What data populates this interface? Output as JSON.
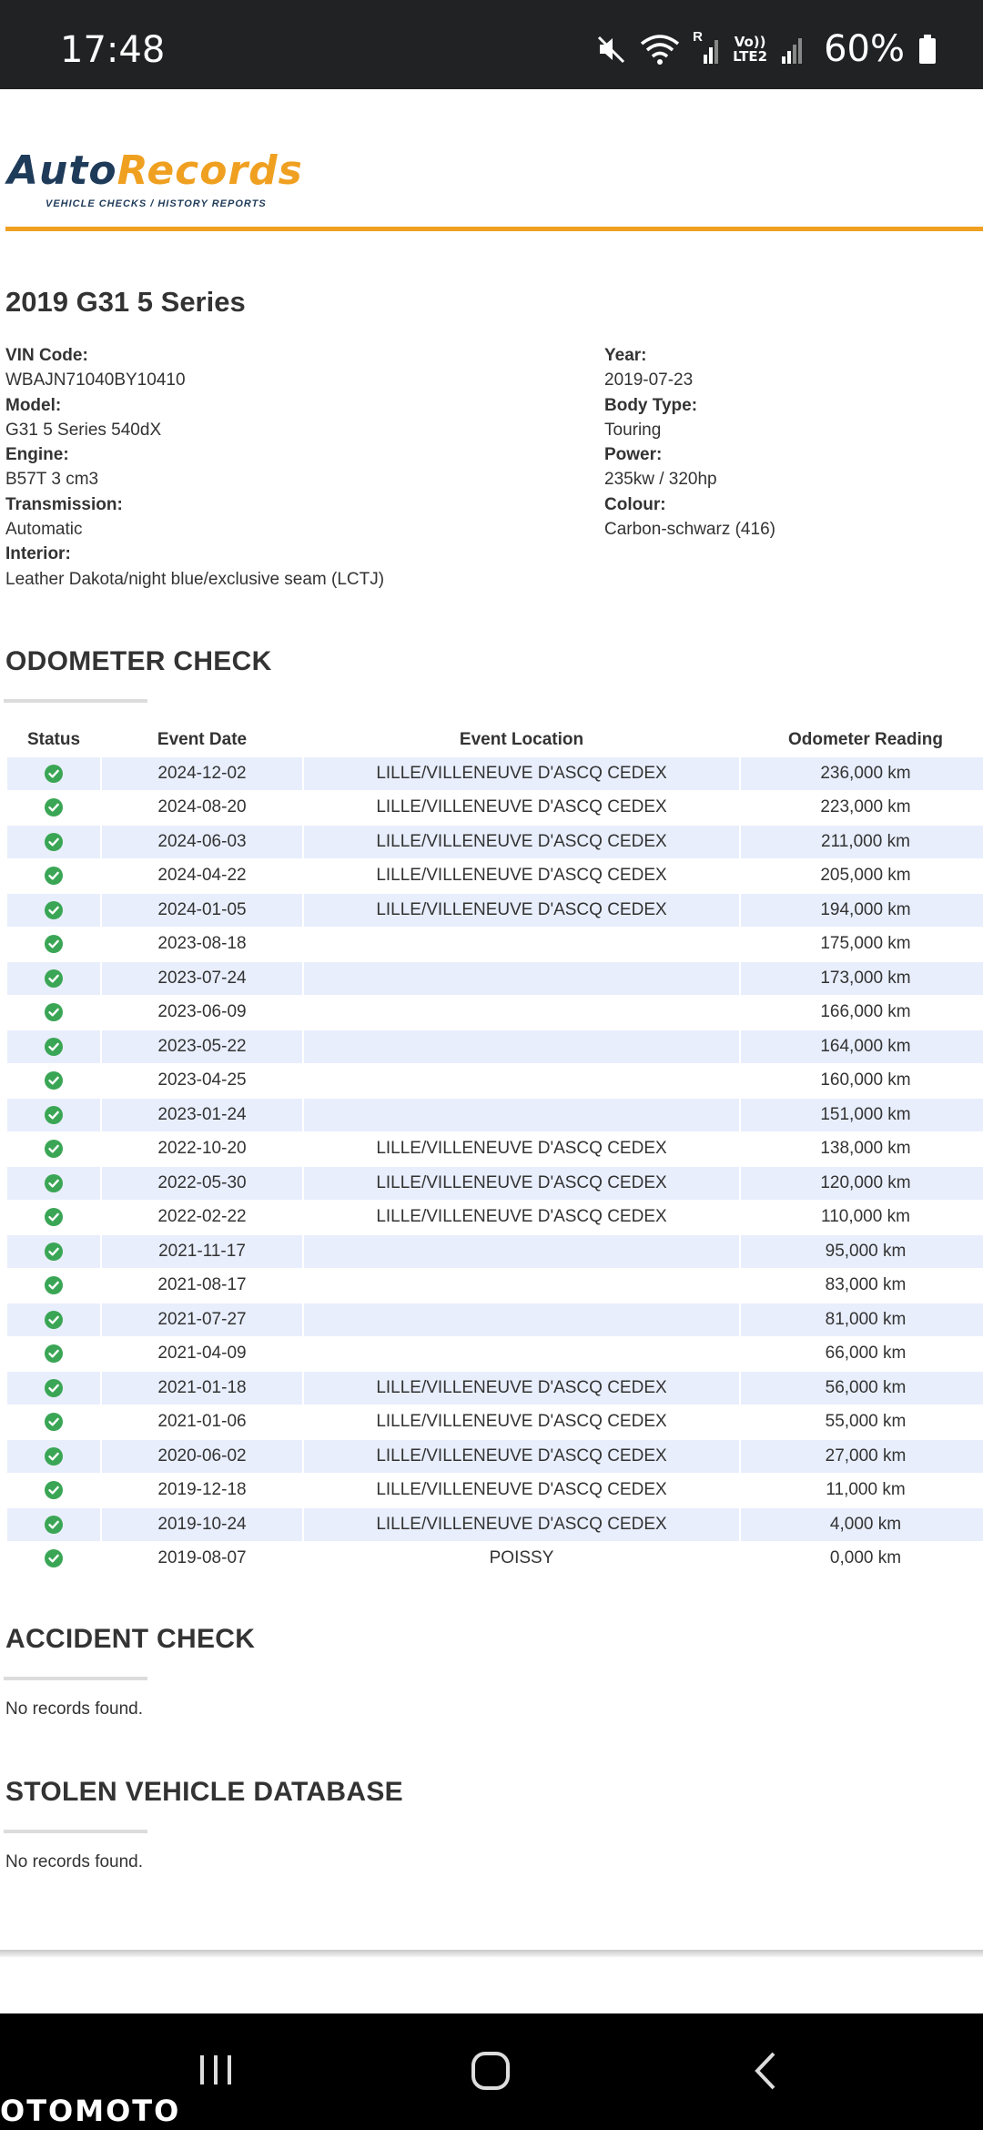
{
  "status_bar": {
    "time": "17:48",
    "battery": "60%",
    "roaming": "R",
    "lte_top": "Vo))",
    "lte_bottom": "LTE2"
  },
  "brand": {
    "auto": "Auto",
    "records": "Records",
    "tagline": "VEHICLE CHECKS / HISTORY REPORTS",
    "color_primary": "#1f3b5a",
    "color_accent": "#f0a020"
  },
  "vehicle": {
    "title": "2019 G31 5 Series",
    "left": [
      {
        "label": "VIN Code:",
        "value": "WBAJN71040BY10410"
      },
      {
        "label": "Model:",
        "value": "G31 5 Series 540dX"
      },
      {
        "label": "Engine:",
        "value": "B57T 3 cm3"
      },
      {
        "label": "Transmission:",
        "value": "Automatic"
      },
      {
        "label": "Interior:",
        "value": "Leather Dakota/night blue/exclusive seam (LCTJ)"
      }
    ],
    "right": [
      {
        "label": "Year:",
        "value": "2019-07-23"
      },
      {
        "label": "Body Type:",
        "value": "Touring"
      },
      {
        "label": "Power:",
        "value": "235kw / 320hp"
      },
      {
        "label": "Colour:",
        "value": "Carbon-schwarz (416)"
      }
    ]
  },
  "odometer": {
    "title": "ODOMETER CHECK",
    "columns": [
      "Status",
      "Event Date",
      "Event Location",
      "Odometer Reading"
    ],
    "status_icon": "check-circle-icon",
    "status_color": "#3aa655",
    "rows": [
      {
        "date": "2024-12-02",
        "location": "LILLE/VILLENEUVE D'ASCQ CEDEX",
        "reading": "236,000 km"
      },
      {
        "date": "2024-08-20",
        "location": "LILLE/VILLENEUVE D'ASCQ CEDEX",
        "reading": "223,000 km"
      },
      {
        "date": "2024-06-03",
        "location": "LILLE/VILLENEUVE D'ASCQ CEDEX",
        "reading": "211,000 km"
      },
      {
        "date": "2024-04-22",
        "location": "LILLE/VILLENEUVE D'ASCQ CEDEX",
        "reading": "205,000 km"
      },
      {
        "date": "2024-01-05",
        "location": "LILLE/VILLENEUVE D'ASCQ CEDEX",
        "reading": "194,000 km"
      },
      {
        "date": "2023-08-18",
        "location": "",
        "reading": "175,000 km"
      },
      {
        "date": "2023-07-24",
        "location": "",
        "reading": "173,000 km"
      },
      {
        "date": "2023-06-09",
        "location": "",
        "reading": "166,000 km"
      },
      {
        "date": "2023-05-22",
        "location": "",
        "reading": "164,000 km"
      },
      {
        "date": "2023-04-25",
        "location": "",
        "reading": "160,000 km"
      },
      {
        "date": "2023-01-24",
        "location": "",
        "reading": "151,000 km"
      },
      {
        "date": "2022-10-20",
        "location": "LILLE/VILLENEUVE D'ASCQ CEDEX",
        "reading": "138,000 km"
      },
      {
        "date": "2022-05-30",
        "location": "LILLE/VILLENEUVE D'ASCQ CEDEX",
        "reading": "120,000 km"
      },
      {
        "date": "2022-02-22",
        "location": "LILLE/VILLENEUVE D'ASCQ CEDEX",
        "reading": "110,000 km"
      },
      {
        "date": "2021-11-17",
        "location": "",
        "reading": "95,000 km"
      },
      {
        "date": "2021-08-17",
        "location": "",
        "reading": "83,000 km"
      },
      {
        "date": "2021-07-27",
        "location": "",
        "reading": "81,000 km"
      },
      {
        "date": "2021-04-09",
        "location": "",
        "reading": "66,000 km"
      },
      {
        "date": "2021-01-18",
        "location": "LILLE/VILLENEUVE D'ASCQ CEDEX",
        "reading": "56,000 km"
      },
      {
        "date": "2021-01-06",
        "location": "LILLE/VILLENEUVE D'ASCQ CEDEX",
        "reading": "55,000 km"
      },
      {
        "date": "2020-06-02",
        "location": "LILLE/VILLENEUVE D'ASCQ CEDEX",
        "reading": "27,000 km"
      },
      {
        "date": "2019-12-18",
        "location": "LILLE/VILLENEUVE D'ASCQ CEDEX",
        "reading": "11,000 km"
      },
      {
        "date": "2019-10-24",
        "location": "LILLE/VILLENEUVE D'ASCQ CEDEX",
        "reading": "4,000 km"
      },
      {
        "date": "2019-08-07",
        "location": "POISSY",
        "reading": "0,000 km"
      }
    ]
  },
  "accident": {
    "title": "ACCIDENT CHECK",
    "text": "No records found."
  },
  "stolen": {
    "title": "STOLEN VEHICLE DATABASE",
    "text": "No records found."
  },
  "watermark": "OTOMOTO"
}
